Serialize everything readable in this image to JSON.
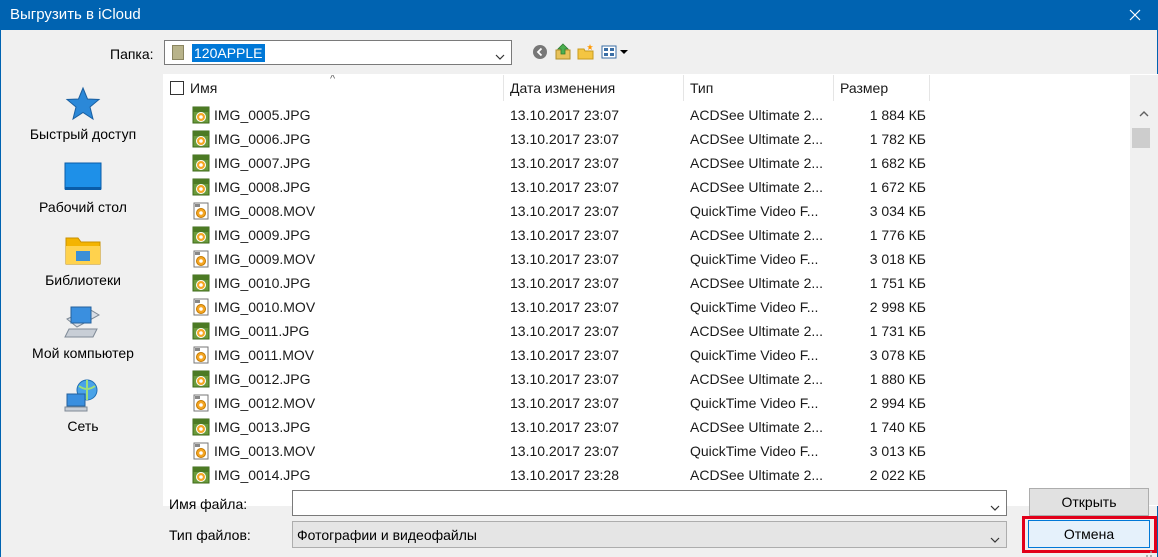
{
  "window": {
    "title": "Выгрузить в iCloud"
  },
  "folder": {
    "label": "Папка:",
    "value": "120APPLE"
  },
  "toolbar_icons": [
    "back-icon",
    "up-folder-icon",
    "new-folder-icon",
    "view-menu-icon"
  ],
  "places": [
    {
      "label": "Быстрый доступ",
      "icon": "star-icon"
    },
    {
      "label": "Рабочий стол",
      "icon": "desktop-icon"
    },
    {
      "label": "Библиотеки",
      "icon": "libraries-icon"
    },
    {
      "label": "Мой компьютер",
      "icon": "computer-icon"
    },
    {
      "label": "Сеть",
      "icon": "network-icon"
    }
  ],
  "columns": {
    "name": "Имя",
    "date": "Дата изменения",
    "type": "Тип",
    "size": "Размер"
  },
  "files": [
    {
      "name": "IMG_0005.JPG",
      "date": "13.10.2017 23:07",
      "type": "ACDSee Ultimate 2...",
      "size": "1 884 КБ",
      "kind": "jpg"
    },
    {
      "name": "IMG_0006.JPG",
      "date": "13.10.2017 23:07",
      "type": "ACDSee Ultimate 2...",
      "size": "1 782 КБ",
      "kind": "jpg"
    },
    {
      "name": "IMG_0007.JPG",
      "date": "13.10.2017 23:07",
      "type": "ACDSee Ultimate 2...",
      "size": "1 682 КБ",
      "kind": "jpg"
    },
    {
      "name": "IMG_0008.JPG",
      "date": "13.10.2017 23:07",
      "type": "ACDSee Ultimate 2...",
      "size": "1 672 КБ",
      "kind": "jpg"
    },
    {
      "name": "IMG_0008.MOV",
      "date": "13.10.2017 23:07",
      "type": "QuickTime Video F...",
      "size": "3 034 КБ",
      "kind": "mov"
    },
    {
      "name": "IMG_0009.JPG",
      "date": "13.10.2017 23:07",
      "type": "ACDSee Ultimate 2...",
      "size": "1 776 КБ",
      "kind": "jpg"
    },
    {
      "name": "IMG_0009.MOV",
      "date": "13.10.2017 23:07",
      "type": "QuickTime Video F...",
      "size": "3 018 КБ",
      "kind": "mov"
    },
    {
      "name": "IMG_0010.JPG",
      "date": "13.10.2017 23:07",
      "type": "ACDSee Ultimate 2...",
      "size": "1 751 КБ",
      "kind": "jpg"
    },
    {
      "name": "IMG_0010.MOV",
      "date": "13.10.2017 23:07",
      "type": "QuickTime Video F...",
      "size": "2 998 КБ",
      "kind": "mov"
    },
    {
      "name": "IMG_0011.JPG",
      "date": "13.10.2017 23:07",
      "type": "ACDSee Ultimate 2...",
      "size": "1 731 КБ",
      "kind": "jpg"
    },
    {
      "name": "IMG_0011.MOV",
      "date": "13.10.2017 23:07",
      "type": "QuickTime Video F...",
      "size": "3 078 КБ",
      "kind": "mov"
    },
    {
      "name": "IMG_0012.JPG",
      "date": "13.10.2017 23:07",
      "type": "ACDSee Ultimate 2...",
      "size": "1 880 КБ",
      "kind": "jpg"
    },
    {
      "name": "IMG_0012.MOV",
      "date": "13.10.2017 23:07",
      "type": "QuickTime Video F...",
      "size": "2 994 КБ",
      "kind": "mov"
    },
    {
      "name": "IMG_0013.JPG",
      "date": "13.10.2017 23:07",
      "type": "ACDSee Ultimate 2...",
      "size": "1 740 КБ",
      "kind": "jpg"
    },
    {
      "name": "IMG_0013.MOV",
      "date": "13.10.2017 23:07",
      "type": "QuickTime Video F...",
      "size": "3 013 КБ",
      "kind": "mov"
    },
    {
      "name": "IMG_0014.JPG",
      "date": "13.10.2017 23:28",
      "type": "ACDSee Ultimate 2...",
      "size": "2 022 КБ",
      "kind": "jpg"
    }
  ],
  "file_name": {
    "label": "Имя файла:",
    "value": ""
  },
  "file_type": {
    "label": "Тип файлов:",
    "value": "Фотографии и видеофайлы"
  },
  "buttons": {
    "open": "Открыть",
    "cancel": "Отмена"
  },
  "colors": {
    "titlebar": "#0063b1",
    "highlight": "#e2001a",
    "selection": "#0078d7"
  }
}
